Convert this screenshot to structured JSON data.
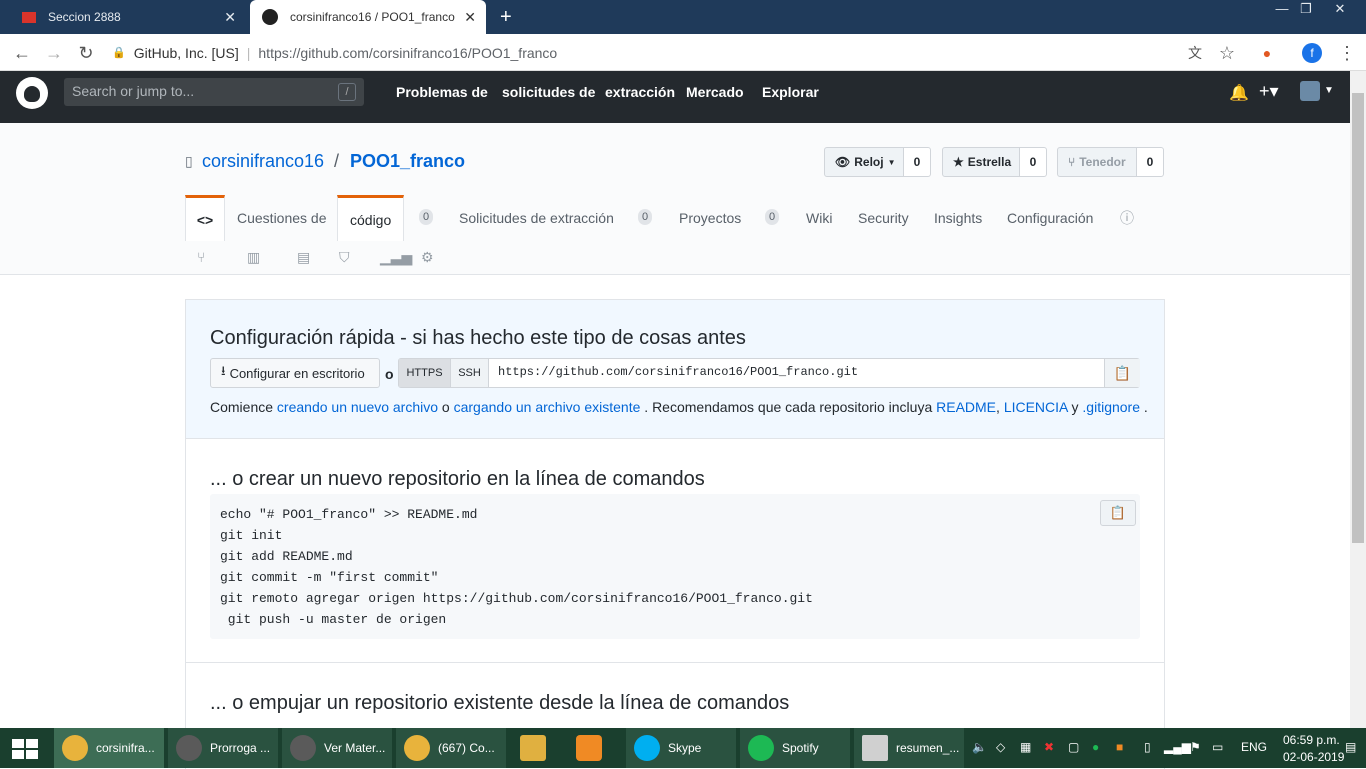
{
  "browser": {
    "tabs": [
      {
        "title": "Seccion 2888",
        "icon": "flag-icon"
      },
      {
        "title": "corsinifranco16 / POO1_franco",
        "icon": "github-icon"
      }
    ],
    "new_tab": "+",
    "close": "✕",
    "security_label": "GitHub, Inc. [US]",
    "url": "https://github.com/corsinifranco16/POO1_franco",
    "profile_letter": "f"
  },
  "gh_header": {
    "search_placeholder": "Search or jump to...",
    "search_key": "/",
    "nav": [
      "Problemas de",
      "solicitudes de",
      "extracción",
      "Mercado",
      "Explorar"
    ]
  },
  "repo": {
    "owner": "corsinifranco16",
    "separator": "/",
    "name": "POO1_franco",
    "watch_label": "Reloj",
    "watch_count": "0",
    "star_label": "Estrella",
    "star_count": "0",
    "fork_label": "Tenedor",
    "fork_count": "0",
    "tabs": {
      "code_icon": "<>",
      "issues": "Cuestiones de",
      "code": "código",
      "code_count": "0",
      "pulls": "Solicitudes de extracción",
      "pulls_count": "0",
      "projects": "Proyectos",
      "projects_count": "0",
      "wiki": "Wiki",
      "security": "Security",
      "insights": "Insights",
      "settings": "Configuración"
    }
  },
  "quick_setup": {
    "title": "Configuración rápida - si has hecho este tipo de cosas antes",
    "desktop_button": "Configurar en escritorio",
    "or": "o",
    "https": "HTTPS",
    "ssh": "SSH",
    "clone_url": "https://github.com/corsinifranco16/POO1_franco.git",
    "text_start": "Comience",
    "link_create": "creando un nuevo archivo",
    "text_or": "o",
    "link_upload": "cargando un archivo existente",
    "text_recommend": ". Recomendamos que cada repositorio incluya",
    "link_readme": "README",
    "text_comma": ",",
    "link_license": "LICENCIA",
    "text_and": "y",
    "link_gitignore": ".gitignore",
    "text_end": "."
  },
  "new_repo": {
    "title": "... o crear un nuevo repositorio en la línea de comandos",
    "code": "echo \"# POO1_franco\" >> README.md\ngit init\ngit add README.md\ngit commit -m \"first commit\"\ngit remoto agregar origen https://github.com/corsinifranco16/POO1_franco.git\n git push -u master de origen"
  },
  "push_repo": {
    "title": "... o empujar un repositorio existente desde la línea de comandos"
  },
  "taskbar": {
    "items": [
      {
        "label": "corsinifra...",
        "color": "#e8b33c"
      },
      {
        "label": "Prorroga ...",
        "color": "#5a5a5a"
      },
      {
        "label": "Ver Mater...",
        "color": "#5a5a5a"
      },
      {
        "label": "(667) Co...",
        "color": "#e8b33c"
      },
      {
        "label": "",
        "color": "#e0b040"
      },
      {
        "label": "",
        "color": "#f08a24"
      },
      {
        "label": "Skype",
        "color": "#00aff0"
      },
      {
        "label": "Spotify",
        "color": "#1db954"
      },
      {
        "label": "resumen_...",
        "color": "#d0d0d0"
      }
    ],
    "lang": "ENG",
    "time": "06:59 p.m.",
    "date": "02-06-2019"
  }
}
